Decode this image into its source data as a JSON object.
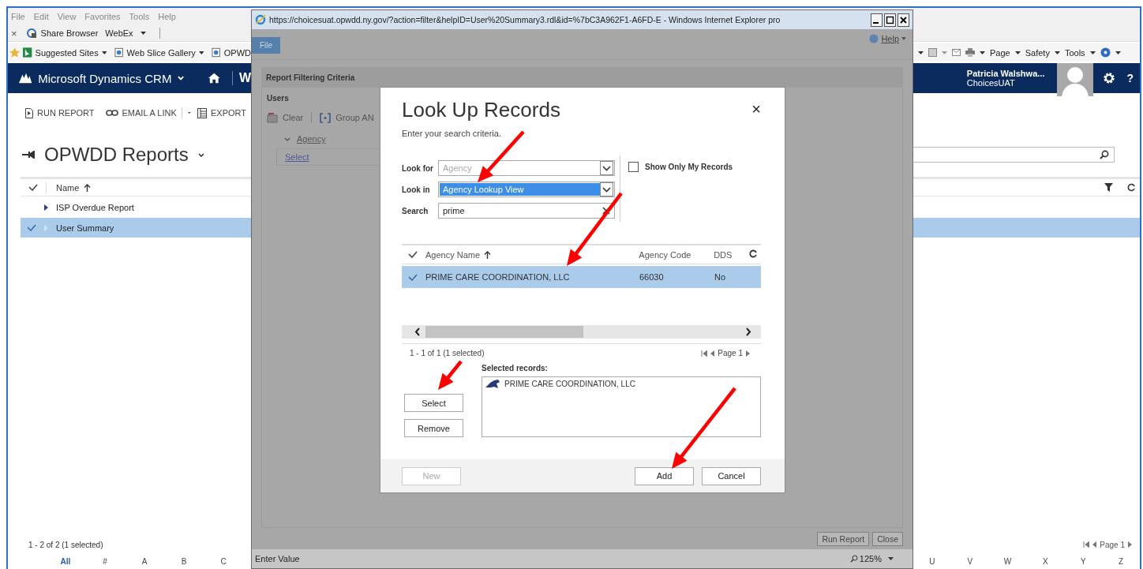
{
  "browser": {
    "menu": [
      "File",
      "Edit",
      "View",
      "Favorites",
      "Tools",
      "Help"
    ],
    "close_glyph": "×",
    "links_bar": [
      {
        "label": "Share Browser",
        "caret": false
      },
      {
        "label": "WebEx",
        "caret": true
      }
    ],
    "favorites": [
      {
        "label": "Suggested Sites",
        "caret": true
      },
      {
        "label": "Web Slice Gallery",
        "caret": true
      },
      {
        "label": "OPWD",
        "caret": false
      }
    ],
    "tools": [
      "Page",
      "Safety",
      "Tools"
    ]
  },
  "crm": {
    "app": "Microsoft Dynamics CRM",
    "nav_cut": "W",
    "user": "Patricia Walshwa...",
    "org": "ChoicesUAT",
    "help": "?"
  },
  "commands": [
    {
      "kind": "run",
      "label": "RUN REPORT"
    },
    {
      "kind": "email",
      "label": "EMAIL A LINK"
    },
    {
      "kind": "export",
      "label": "EXPORT"
    }
  ],
  "view": {
    "title": "OPWDD Reports",
    "column": "Name",
    "rows": [
      {
        "name": "ISP Overdue Report",
        "selected": false
      },
      {
        "name": "User Summary",
        "selected": true
      }
    ],
    "status": "1 - 2 of 2 (1 selected)",
    "page": "Page 1",
    "letters_left": [
      {
        "label": "All",
        "selected": true
      },
      {
        "label": "#",
        "selected": false
      },
      {
        "label": "A",
        "selected": false
      },
      {
        "label": "B",
        "selected": false
      },
      {
        "label": "C",
        "selected": false
      }
    ],
    "letters_right": [
      {
        "label": "U",
        "selected": false
      },
      {
        "label": "V",
        "selected": false
      },
      {
        "label": "W",
        "selected": false
      },
      {
        "label": "X",
        "selected": false
      },
      {
        "label": "Y",
        "selected": false
      },
      {
        "label": "Z",
        "selected": false
      }
    ]
  },
  "report_window": {
    "title": "https://choicesuat.opwdd.ny.gov/?action=filter&helpID=User%20Summary3.rdl&id=%7bC3A962F1-A6FD-E - Windows Internet Explorer pro",
    "menu": "File",
    "help": "Help",
    "section": "Report Filtering Criteria",
    "group": "Users",
    "tools": [
      "Clear",
      "Group AN"
    ],
    "field": "Agency",
    "link": "Select",
    "buttons": [
      "Run Report",
      "Close"
    ],
    "status": "Enter Value",
    "zoom": "125%"
  },
  "dialog": {
    "title": "Look Up Records",
    "subtitle": "Enter your search criteria.",
    "close": "×",
    "fields": [
      {
        "label": "Look for",
        "value": "Agency",
        "kind": "dropdown",
        "disabled": true,
        "highlighted": false
      },
      {
        "label": "Look in",
        "value": "Agency Lookup View",
        "kind": "dropdown",
        "disabled": false,
        "highlighted": true
      },
      {
        "label": "Search",
        "value": "prime",
        "kind": "search",
        "disabled": false,
        "highlighted": false
      }
    ],
    "only_mine": {
      "label": "Show Only My Records",
      "checked": false
    },
    "columns": [
      "Agency Name",
      "Agency Code",
      "DDS"
    ],
    "rows": [
      {
        "cells": [
          "PRIME CARE COORDINATION, LLC",
          "66030",
          "No"
        ],
        "selected": true
      }
    ],
    "status": "1 - 1 of 1 (1 selected)",
    "page": "Page 1",
    "selected_label": "Selected records:",
    "selected_records": [
      "PRIME CARE COORDINATION, LLC"
    ],
    "side_buttons": [
      "Select",
      "Remove"
    ],
    "footer_buttons": [
      {
        "label": "New",
        "disabled": true
      },
      {
        "label": "Add",
        "disabled": false
      },
      {
        "label": "Cancel",
        "disabled": false
      }
    ]
  }
}
